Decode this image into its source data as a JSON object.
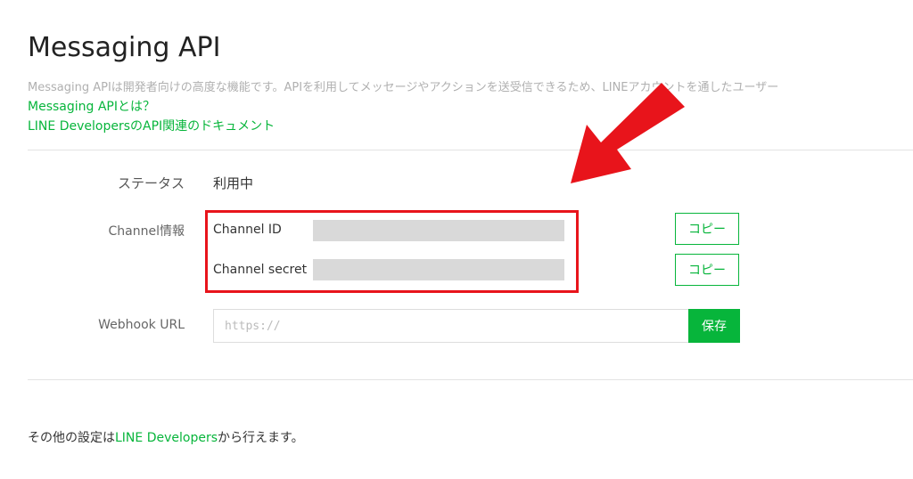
{
  "header": {
    "title": "Messaging API",
    "description": "Messaging APIは開発者向けの高度な機能です。APIを利用してメッセージやアクションを送受信できるため、LINEアカウントを通したユーザー",
    "links": [
      "Messaging APIとは？",
      "LINE DevelopersのAPI関連のドキュメント"
    ]
  },
  "status": {
    "label": "ステータス",
    "value": "利用中"
  },
  "channel_info": {
    "label": "Channel情報",
    "channel_id_label": "Channel ID",
    "channel_secret_label": "Channel secret",
    "copy_label": "コピー"
  },
  "webhook": {
    "label": "Webhook URL",
    "placeholder": "https://",
    "save_label": "保存"
  },
  "footer": {
    "prefix": "その他の設定は",
    "link": "LINE Developers",
    "suffix": "から行えます。"
  },
  "colors": {
    "accent_green": "#07b53b",
    "highlight_red": "#e8141b",
    "masked_gray": "#d9d9d9"
  },
  "icons": {
    "annotation_arrow": "arrow-icon"
  }
}
